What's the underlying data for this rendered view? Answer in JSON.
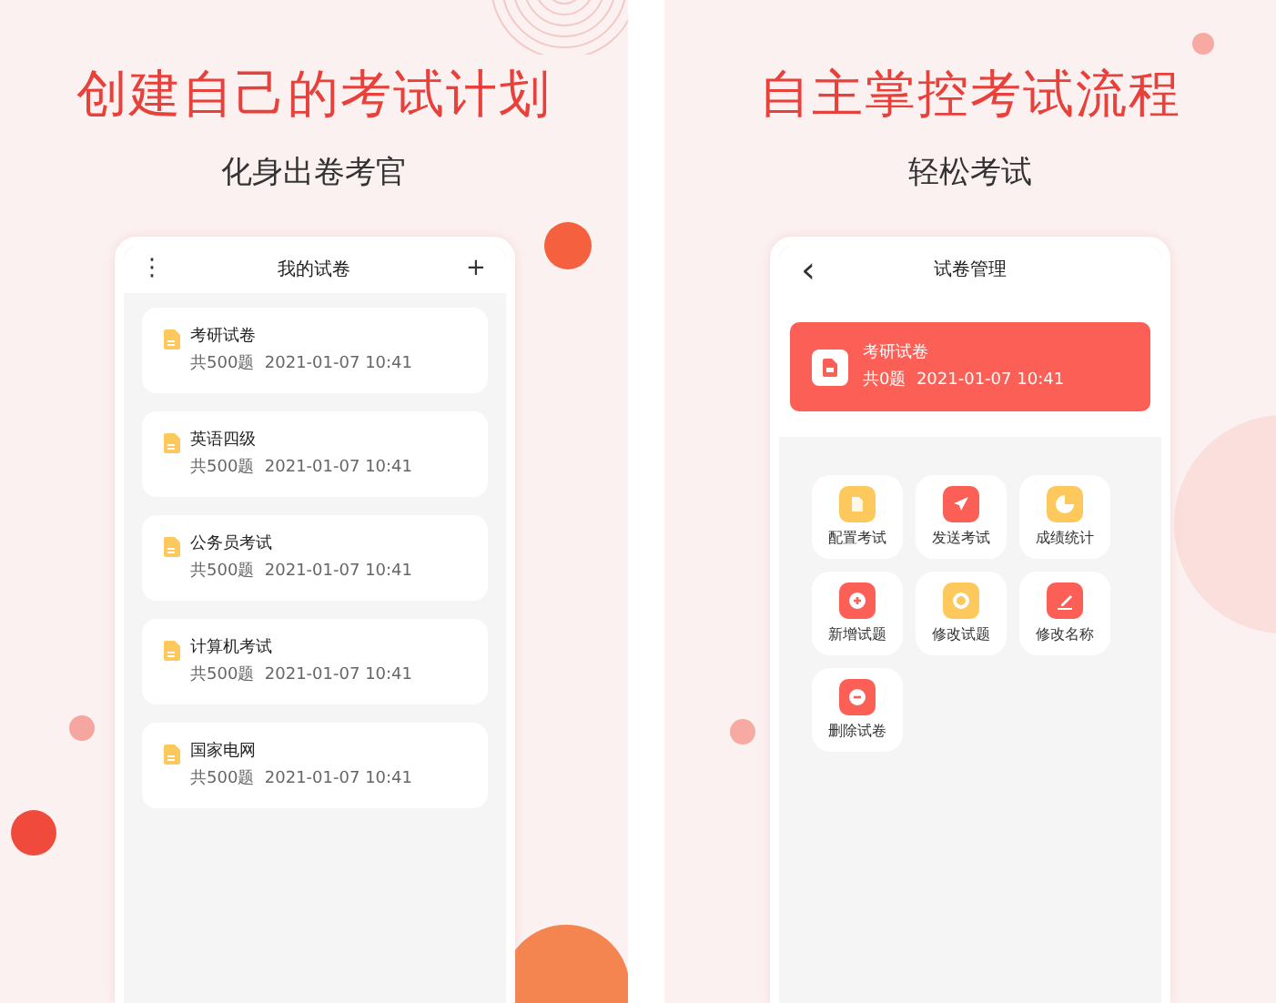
{
  "panels": [
    {
      "headline": "创建自己的考试计划",
      "subtitle": "化身出卷考官",
      "screen": {
        "kind": "list",
        "title": "我的试卷",
        "menu": "⋮",
        "add": "+",
        "papers": [
          {
            "name": "考研试卷",
            "meta": "共500题  2021-01-07 10:41"
          },
          {
            "name": "英语四级",
            "meta": "共500题  2021-01-07 10:41"
          },
          {
            "name": "公务员考试",
            "meta": "共500题  2021-01-07 10:41"
          },
          {
            "name": "计算机考试",
            "meta": "共500题  2021-01-07 10:41"
          },
          {
            "name": "国家电网",
            "meta": "共500题  2021-01-07 10:41"
          }
        ]
      }
    },
    {
      "headline": "自主掌控考试流程",
      "subtitle": "轻松考试",
      "screen": {
        "kind": "manage",
        "title": "试卷管理",
        "back": "‹",
        "paper": {
          "name": "考研试卷",
          "meta": "共0题  2021-01-07 10:41"
        },
        "tools": [
          {
            "label": "配置考试",
            "color": "#fdc95c"
          },
          {
            "label": "发送考试",
            "color": "#fb5f55"
          },
          {
            "label": "成绩统计",
            "color": "#fdc95c"
          },
          {
            "label": "新增试题",
            "color": "#fb5f55"
          },
          {
            "label": "修改试题",
            "color": "#fdc95c"
          },
          {
            "label": "修改名称",
            "color": "#fb5f55"
          },
          {
            "label": "删除试卷",
            "color": "#fb5f55"
          }
        ]
      }
    }
  ]
}
